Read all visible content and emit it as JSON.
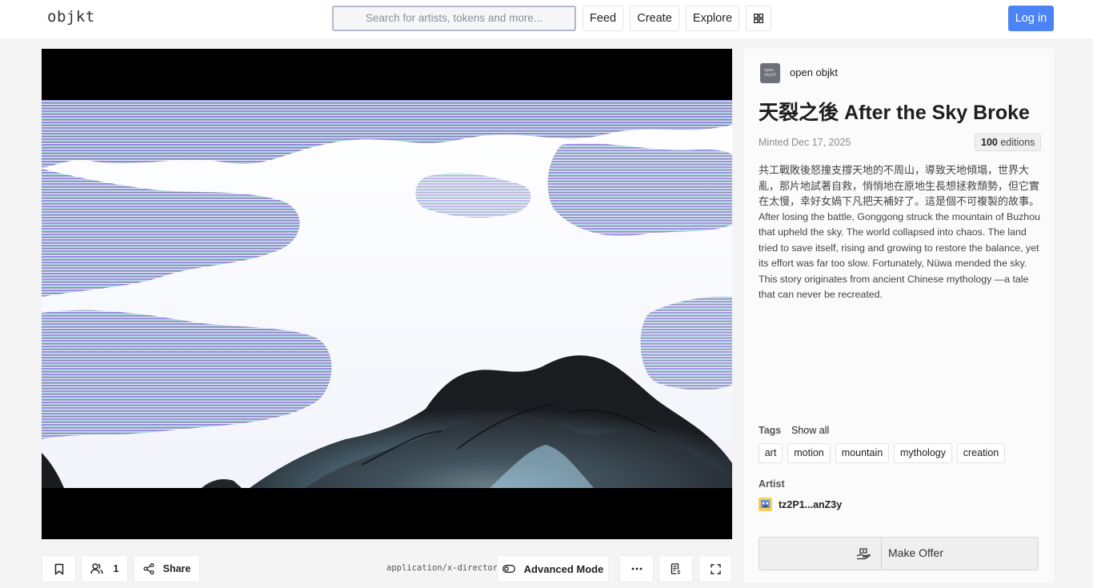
{
  "header": {
    "logo": "objkt",
    "search_placeholder": "Search for artists, tokens and more...",
    "nav": [
      {
        "label": "Feed"
      },
      {
        "label": "Create"
      },
      {
        "label": "Explore"
      }
    ],
    "grid_icon": "grid-icon",
    "login_label": "Log in",
    "accent_color": "#4d84f5"
  },
  "artwork": {
    "alt": "generative landscape artwork"
  },
  "toolbar": {
    "bookmark_icon": "bookmark-icon",
    "owners_icon": "owners-icon",
    "owners_count": "1",
    "share_icon": "share-icon",
    "share_label": "Share",
    "mime": "application/x-directory",
    "advanced_icon": "toggle-icon",
    "advanced_label": "Advanced Mode",
    "more_icon": "more-icon",
    "details_icon": "details-icon",
    "fullscreen_icon": "fullscreen-icon"
  },
  "panel": {
    "collection_avatar_text": "open_ objkt",
    "collection_name": "open objkt",
    "title": "天裂之後 After the Sky Broke",
    "minted": "Minted Dec 17, 2025",
    "editions_count": "100",
    "editions_label": "editions",
    "description_zh": "共工戰敗後怒撞支撐天地的不周山，導致天地傾塌，世界大亂，那片地試著自救，悄悄地在原地生長想拯救頹勢，但它實在太慢，幸好女媧下凡把天補好了。這是個不可複製的故事。",
    "description_en": "After losing the battle, Gonggong struck the mountain of Buzhou that upheld the sky. The world collapsed into chaos. The land tried to save itself, rising and growing to restore the balance, yet its effort was far too slow. Fortunately, Nüwa mended the sky. This story originates from ancient Chinese mythology —a tale that can never be recreated.",
    "tags_heading": "Tags",
    "show_all": "Show all",
    "tags": [
      "art",
      "motion",
      "mountain",
      "mythology",
      "creation"
    ],
    "artist_heading": "Artist",
    "artist_name": "tz2P1...anZ3y",
    "offer_icon": "offer-hand-icon",
    "offer_label": "Make Offer"
  }
}
